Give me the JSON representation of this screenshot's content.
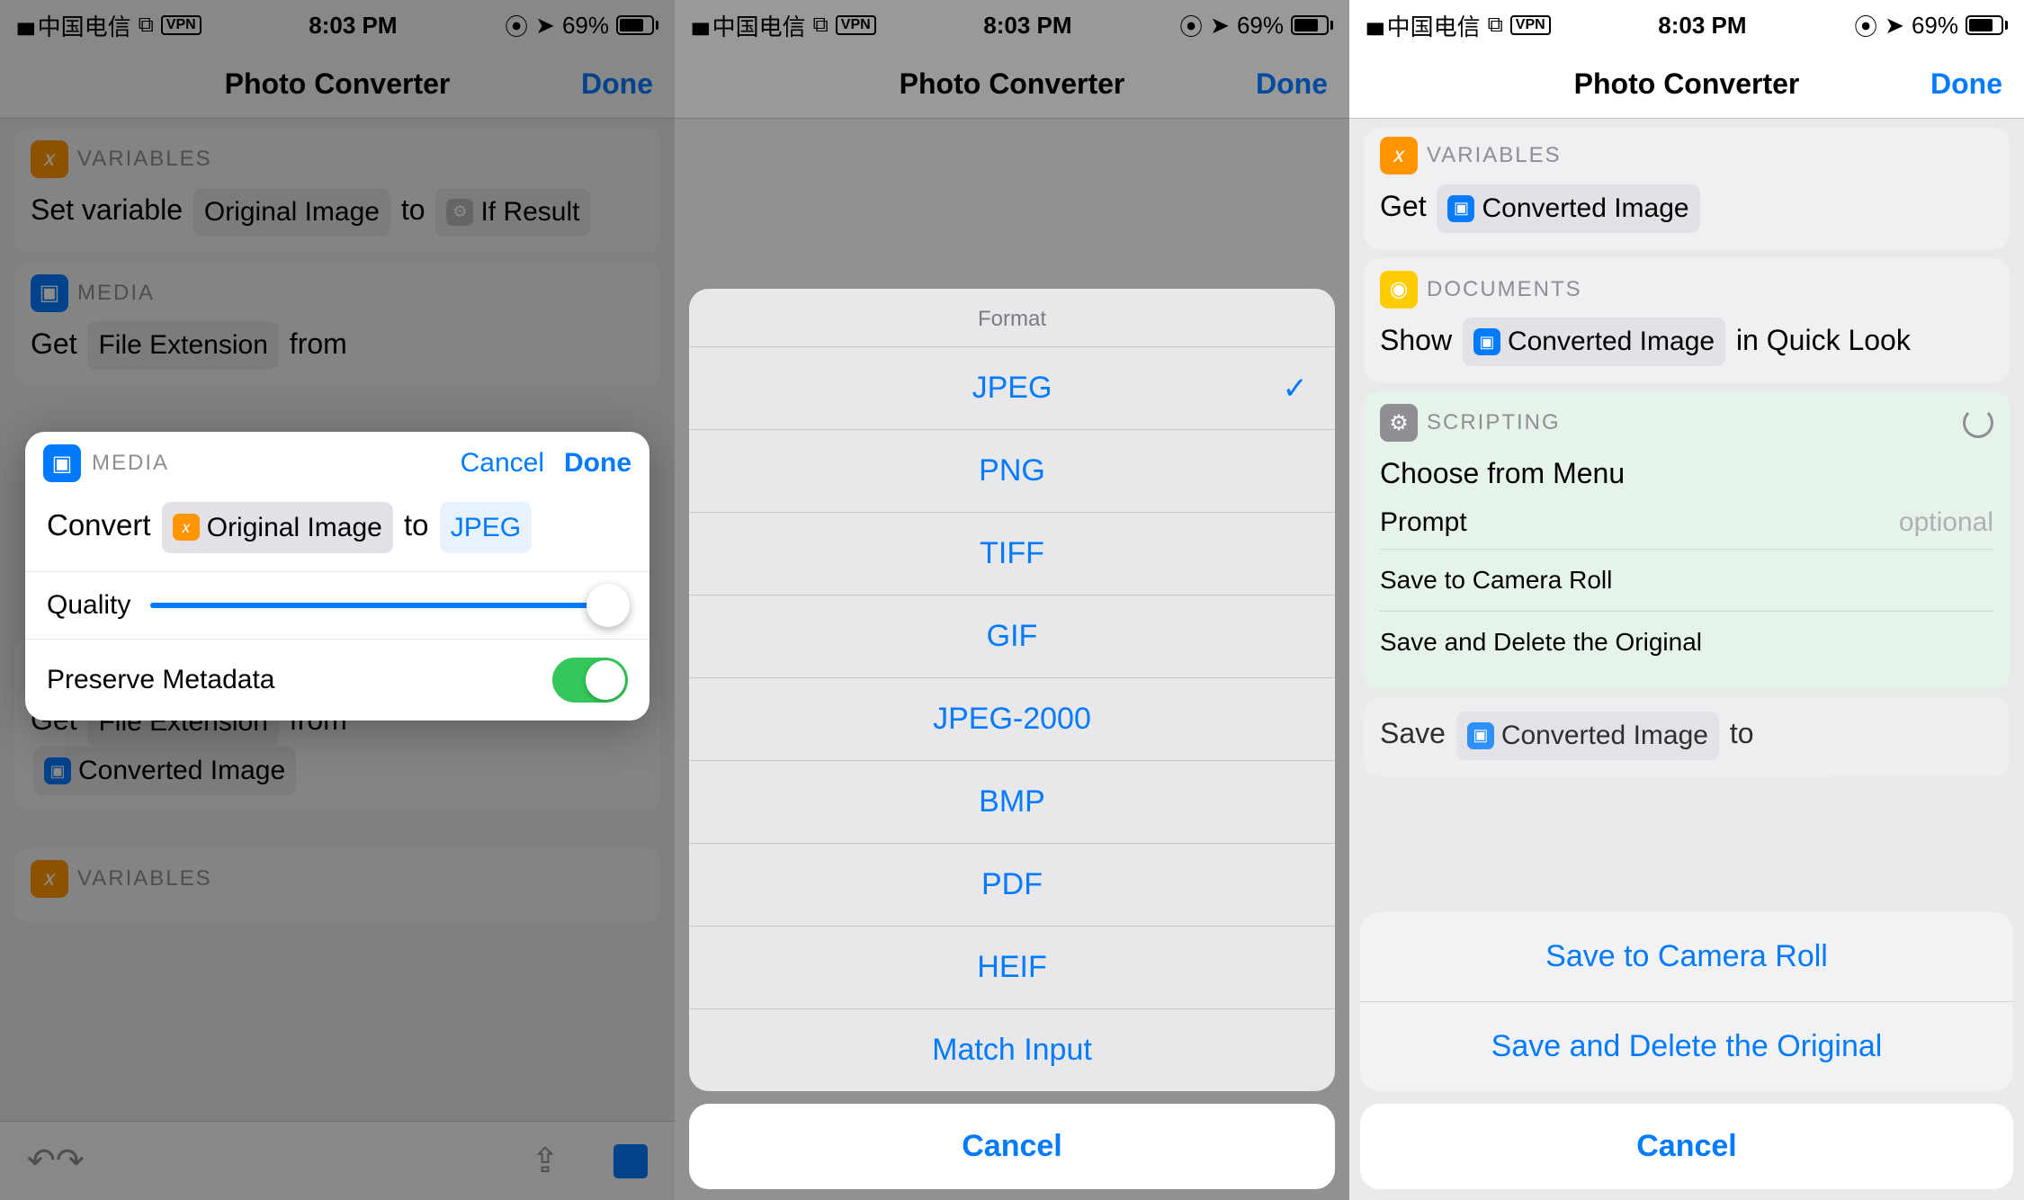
{
  "status": {
    "carrier": "中国电信",
    "vpn": "VPN",
    "time": "8:03 PM",
    "battery_pct": "69%"
  },
  "nav": {
    "title": "Photo Converter",
    "done": "Done"
  },
  "p1": {
    "cards": {
      "variables_label": "VARIABLES",
      "media_label": "MEDIA",
      "set_variable_pre": "Set variable",
      "original_image": "Original Image",
      "to": "to",
      "if_result": "If Result",
      "get": "Get",
      "file_ext": "File Extension",
      "from": "from",
      "converted_image": "Converted Image"
    },
    "popup": {
      "label": "MEDIA",
      "cancel": "Cancel",
      "done": "Done",
      "convert": "Convert",
      "var": "Original Image",
      "to": "to",
      "format": "JPEG",
      "quality": "Quality",
      "preserve": "Preserve Metadata"
    }
  },
  "p2": {
    "sheet_title": "Format",
    "options": [
      "JPEG",
      "PNG",
      "TIFF",
      "GIF",
      "JPEG-2000",
      "BMP",
      "PDF",
      "HEIF",
      "Match Input"
    ],
    "selected": "JPEG",
    "cancel": "Cancel"
  },
  "p3": {
    "variables_label": "VARIABLES",
    "get": "Get",
    "converted_image": "Converted Image",
    "documents_label": "DOCUMENTS",
    "show": "Show",
    "in_quick_look": "in Quick Look",
    "scripting_label": "SCRIPTING",
    "choose_from_menu": "Choose from Menu",
    "prompt": "Prompt",
    "optional": "optional",
    "menu1": "Save to Camera Roll",
    "menu2": "Save and Delete the Original",
    "save": "Save",
    "to": "to",
    "sheet": {
      "opt1": "Save to Camera Roll",
      "opt2": "Save and Delete the Original",
      "cancel": "Cancel"
    }
  }
}
